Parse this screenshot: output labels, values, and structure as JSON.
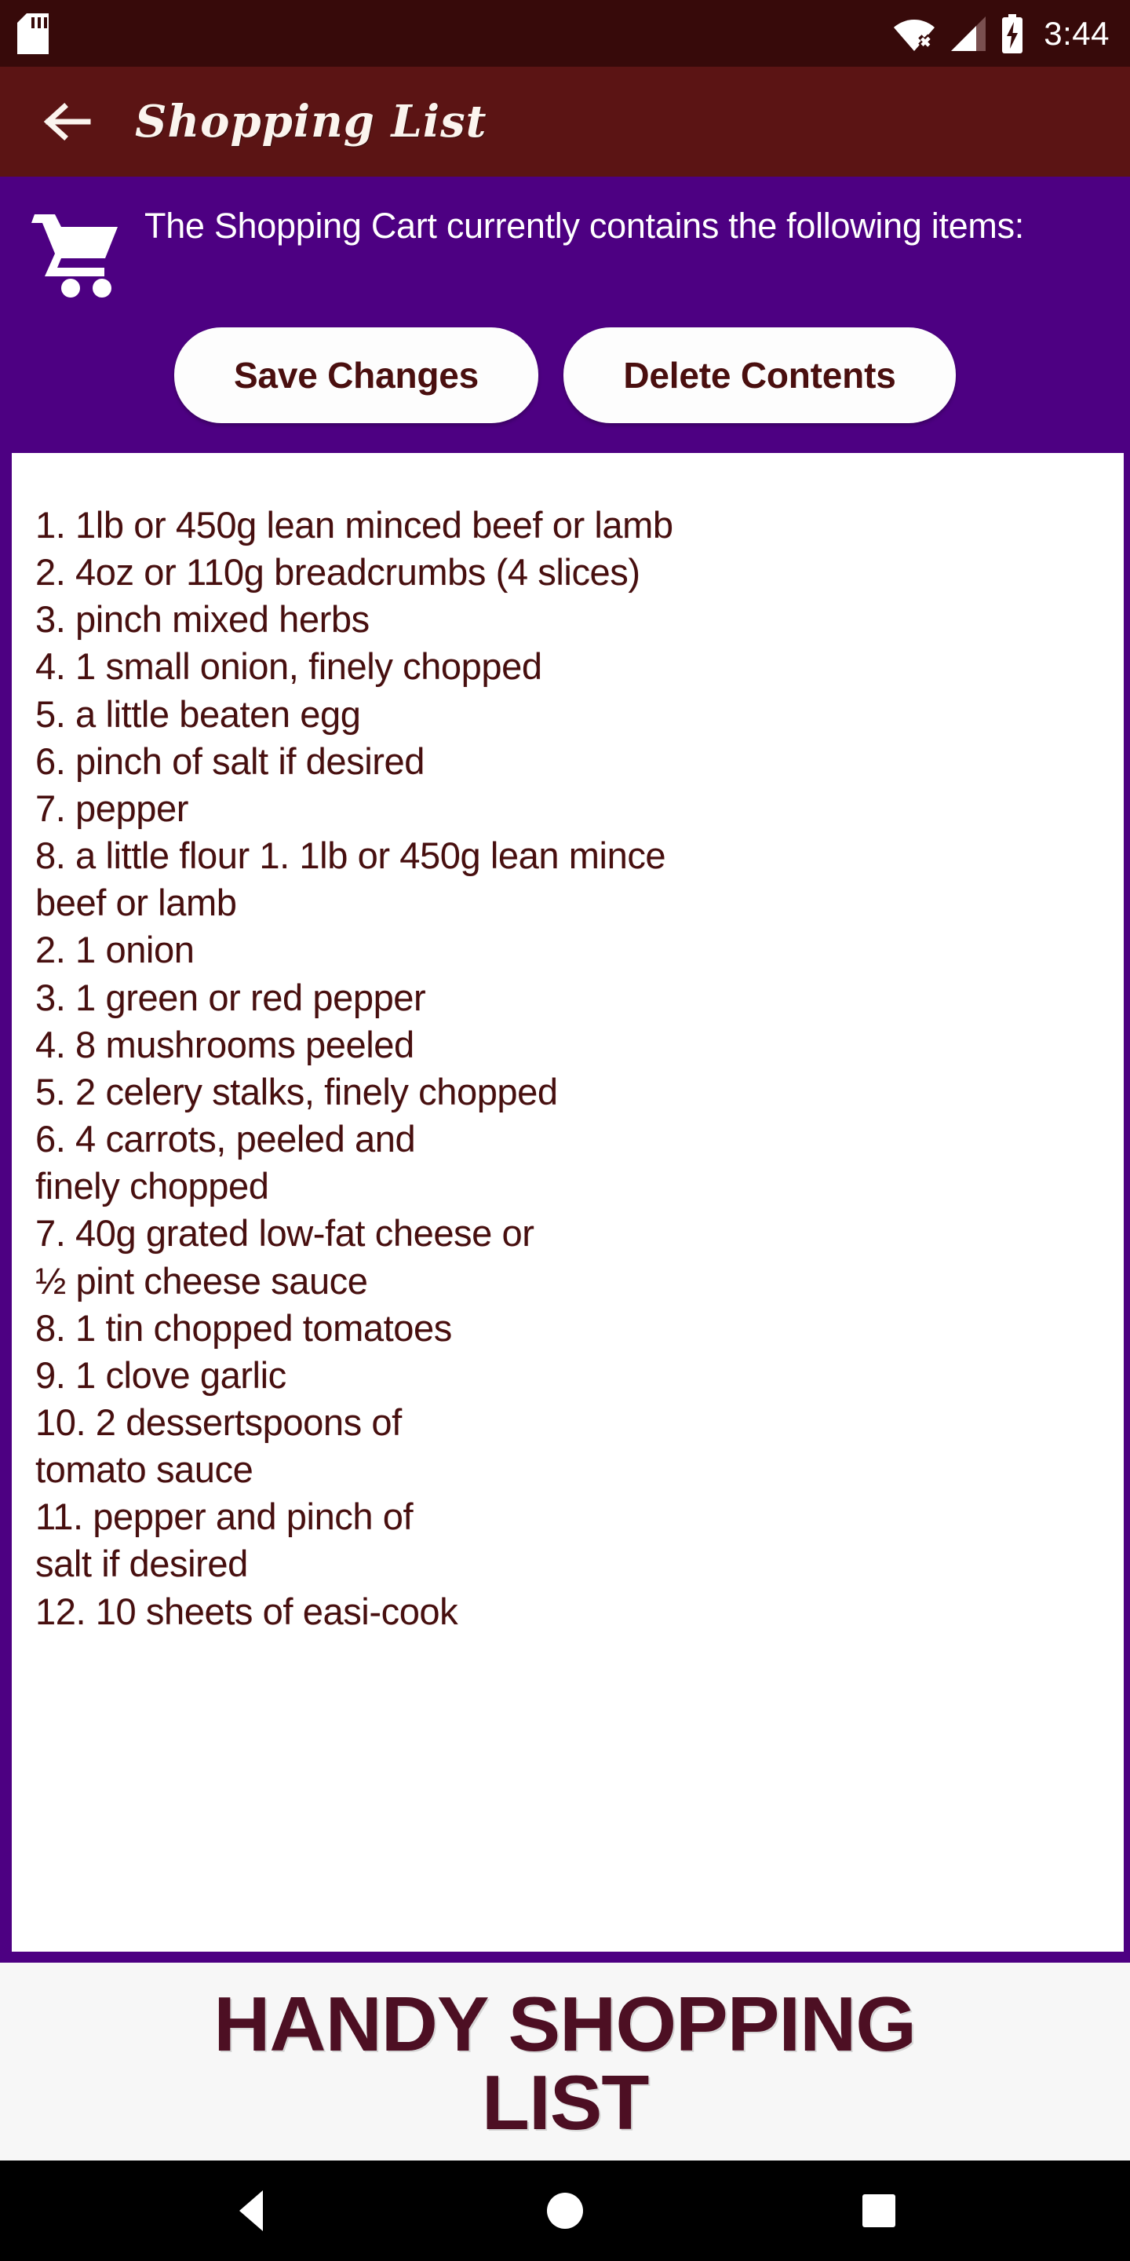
{
  "statusbar": {
    "time": "3:44",
    "icons": [
      "sd-card-icon",
      "wifi-no-internet-icon",
      "cellular-signal-icon",
      "battery-charging-icon"
    ]
  },
  "appbar": {
    "title": "Shopping List",
    "back_icon": "arrow-left-icon"
  },
  "cart_panel": {
    "icon": "shopping-cart-icon",
    "message": "The Shopping Cart currently contains the following items:",
    "save_label": "Save Changes",
    "delete_label": "Delete Contents"
  },
  "list": {
    "lines": [
      "1. 1lb or 450g lean minced beef or lamb",
      "2. 4oz or 110g breadcrumbs (4 slices)",
      "3. pinch mixed herbs",
      "4. 1 small onion, finely chopped",
      "5. a little beaten egg",
      "6. pinch of salt if desired",
      "7. pepper",
      "8. a little flour 1. 1lb or 450g lean mince",
      "beef or lamb",
      "2. 1 onion",
      "3. 1 green or red pepper",
      "4. 8 mushrooms peeled",
      "5. 2 celery stalks, finely chopped",
      "6. 4 carrots, peeled and",
      "finely chopped",
      "7. 40g grated low-fat cheese or",
      "½ pint cheese sauce",
      "8. 1 tin chopped tomatoes",
      "9. 1 clove garlic",
      "10. 2 dessertspoons of",
      "tomato sauce",
      "11. pepper and pinch of",
      "salt if desired",
      "12. 10 sheets of easi-cook"
    ]
  },
  "banner": {
    "line1": "HANDY SHOPPING",
    "line2": "LIST"
  },
  "navbar": {
    "back_label": "back-triangle-icon",
    "home_label": "home-circle-icon",
    "recents_label": "recents-square-icon"
  },
  "colors": {
    "status_bar": "#370a0a",
    "app_bar": "#5b1414",
    "purple": "#4d0082",
    "card": "#ffffff",
    "text_maroon": "#470f0f",
    "banner_text": "#4d0f23",
    "nav_bar": "#000000"
  }
}
